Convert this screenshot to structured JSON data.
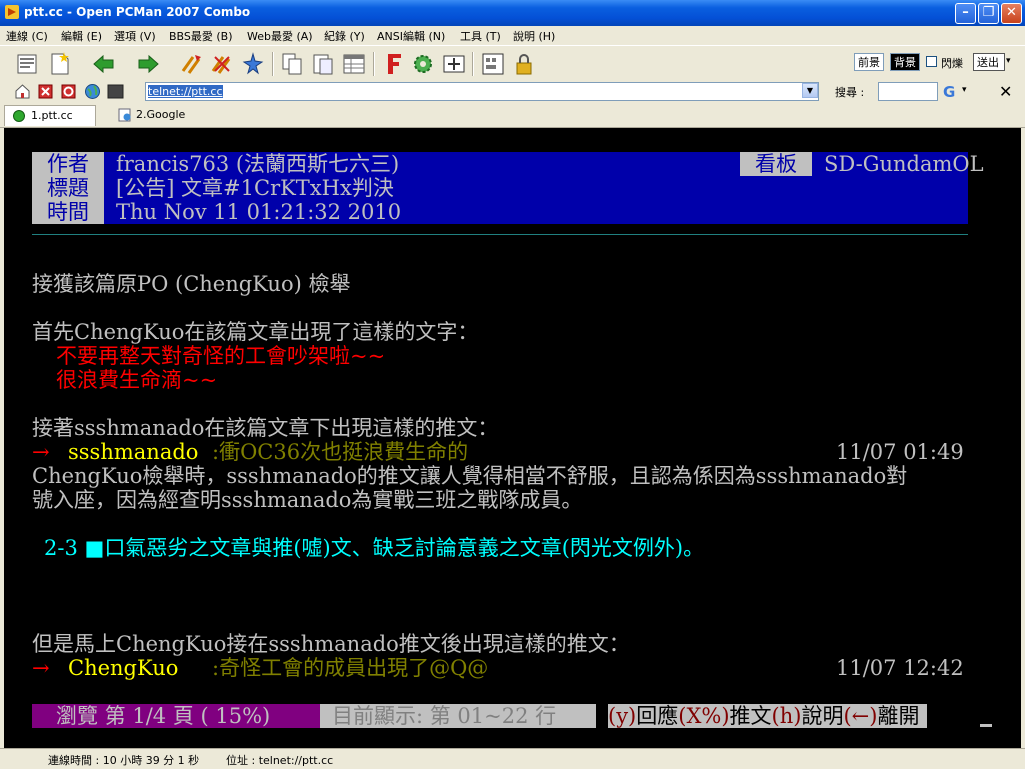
{
  "window": {
    "title": "ptt.cc - Open PCMan 2007 Combo"
  },
  "colors": {
    "title_bar": "#0450d6",
    "terminal_bg": "#000000",
    "header_band": "#0000aa",
    "red": "#ff0000",
    "yellow": "#ffff00",
    "olive": "#808000",
    "cyan": "#00ffff",
    "white": "#ffffff",
    "status_magenta": "#800080"
  },
  "menu": [
    "連線 (C)",
    "編輯 (E)",
    "選項 (V)",
    "BBS最愛 (B)",
    "Web最愛 (A)",
    "紀錄 (Y)",
    "ANSI編輯 (N)",
    "工具 (T)",
    "說明 (H)"
  ],
  "toolbar": {
    "icons": [
      "new-site-icon",
      "add-icon",
      "back-icon",
      "forward-icon",
      "reconnect-icon",
      "disconnect-icon",
      "pin-icon",
      "copy-icon",
      "paste-icon",
      "copy-table-icon",
      "font-icon",
      "settings-icon",
      "fullscreen-icon",
      "keyboard-icon",
      "lock-icon"
    ],
    "fg_label": "前景",
    "bg_label": "背景",
    "blink_label": "閃爍",
    "send_label": "送出"
  },
  "address_bar": {
    "value": "telnet://ptt.cc",
    "search_label": "搜尋 :",
    "search_value": ""
  },
  "tabs": [
    {
      "label": "1.ptt.cc"
    },
    {
      "label": "2.Google"
    }
  ],
  "terminal": {
    "header": {
      "author_label": "作者",
      "author": "francis763 (法蘭西斯七六三)",
      "board_label": "看板",
      "board": "SD-GundamOL",
      "title_label": "標題",
      "title": "[公告] 文章#1CrKTxHx判決",
      "time_label": "時間",
      "time": "Thu Nov 11 01:21:32 2010"
    },
    "lines": {
      "l1": "接獲該篇原PO (ChengKuo) 檢舉",
      "l2": "首先ChengKuo在該篇文章出現了這樣的文字：",
      "l3": "不要再整天對奇怪的工會吵架啦~~",
      "l4": "很浪費生命滴~~",
      "l5": "接著ssshmanado在該篇文章下出現這樣的推文：",
      "push1_arrow": "→",
      "push1_user": "ssshmanado",
      "push1_text": ":衝OC36次也挺浪費生命的",
      "push1_time": "11/07 01:49",
      "l6": "ChengKuo檢舉時，ssshmanado的推文讓人覺得相當不舒服，且認為係因為ssshmanado對",
      "l7": "號入座，因為經查明ssshmanado為實戰三班之戰隊成員。",
      "rule": "2-3 ■口氣惡劣之文章與推(噓)文、缺乏討論意義之文章(閃光文例外)。",
      "l8": "但是馬上ChengKuo接在ssshmanado推文後出現這樣的推文：",
      "push2_arrow": "→",
      "push2_user": "ChengKuo",
      "push2_text": ":奇怪工會的成員出現了@Q@",
      "push2_time": "11/07 12:42"
    },
    "status": {
      "browse": "瀏覽 第 1/4 頁 ( 15%)",
      "display": "目前顯示: 第 01~22 行",
      "k1": "(y)",
      "t1": "回應",
      "k2": "(X%)",
      "t2": "推文",
      "k3": "(h)",
      "t3": "說明",
      "k4": "(←)",
      "t4": "離開"
    }
  },
  "statusbar": {
    "connect_time": "連線時間 : 10 小時 39 分 1 秒",
    "location": "位址 : telnet://ptt.cc"
  }
}
